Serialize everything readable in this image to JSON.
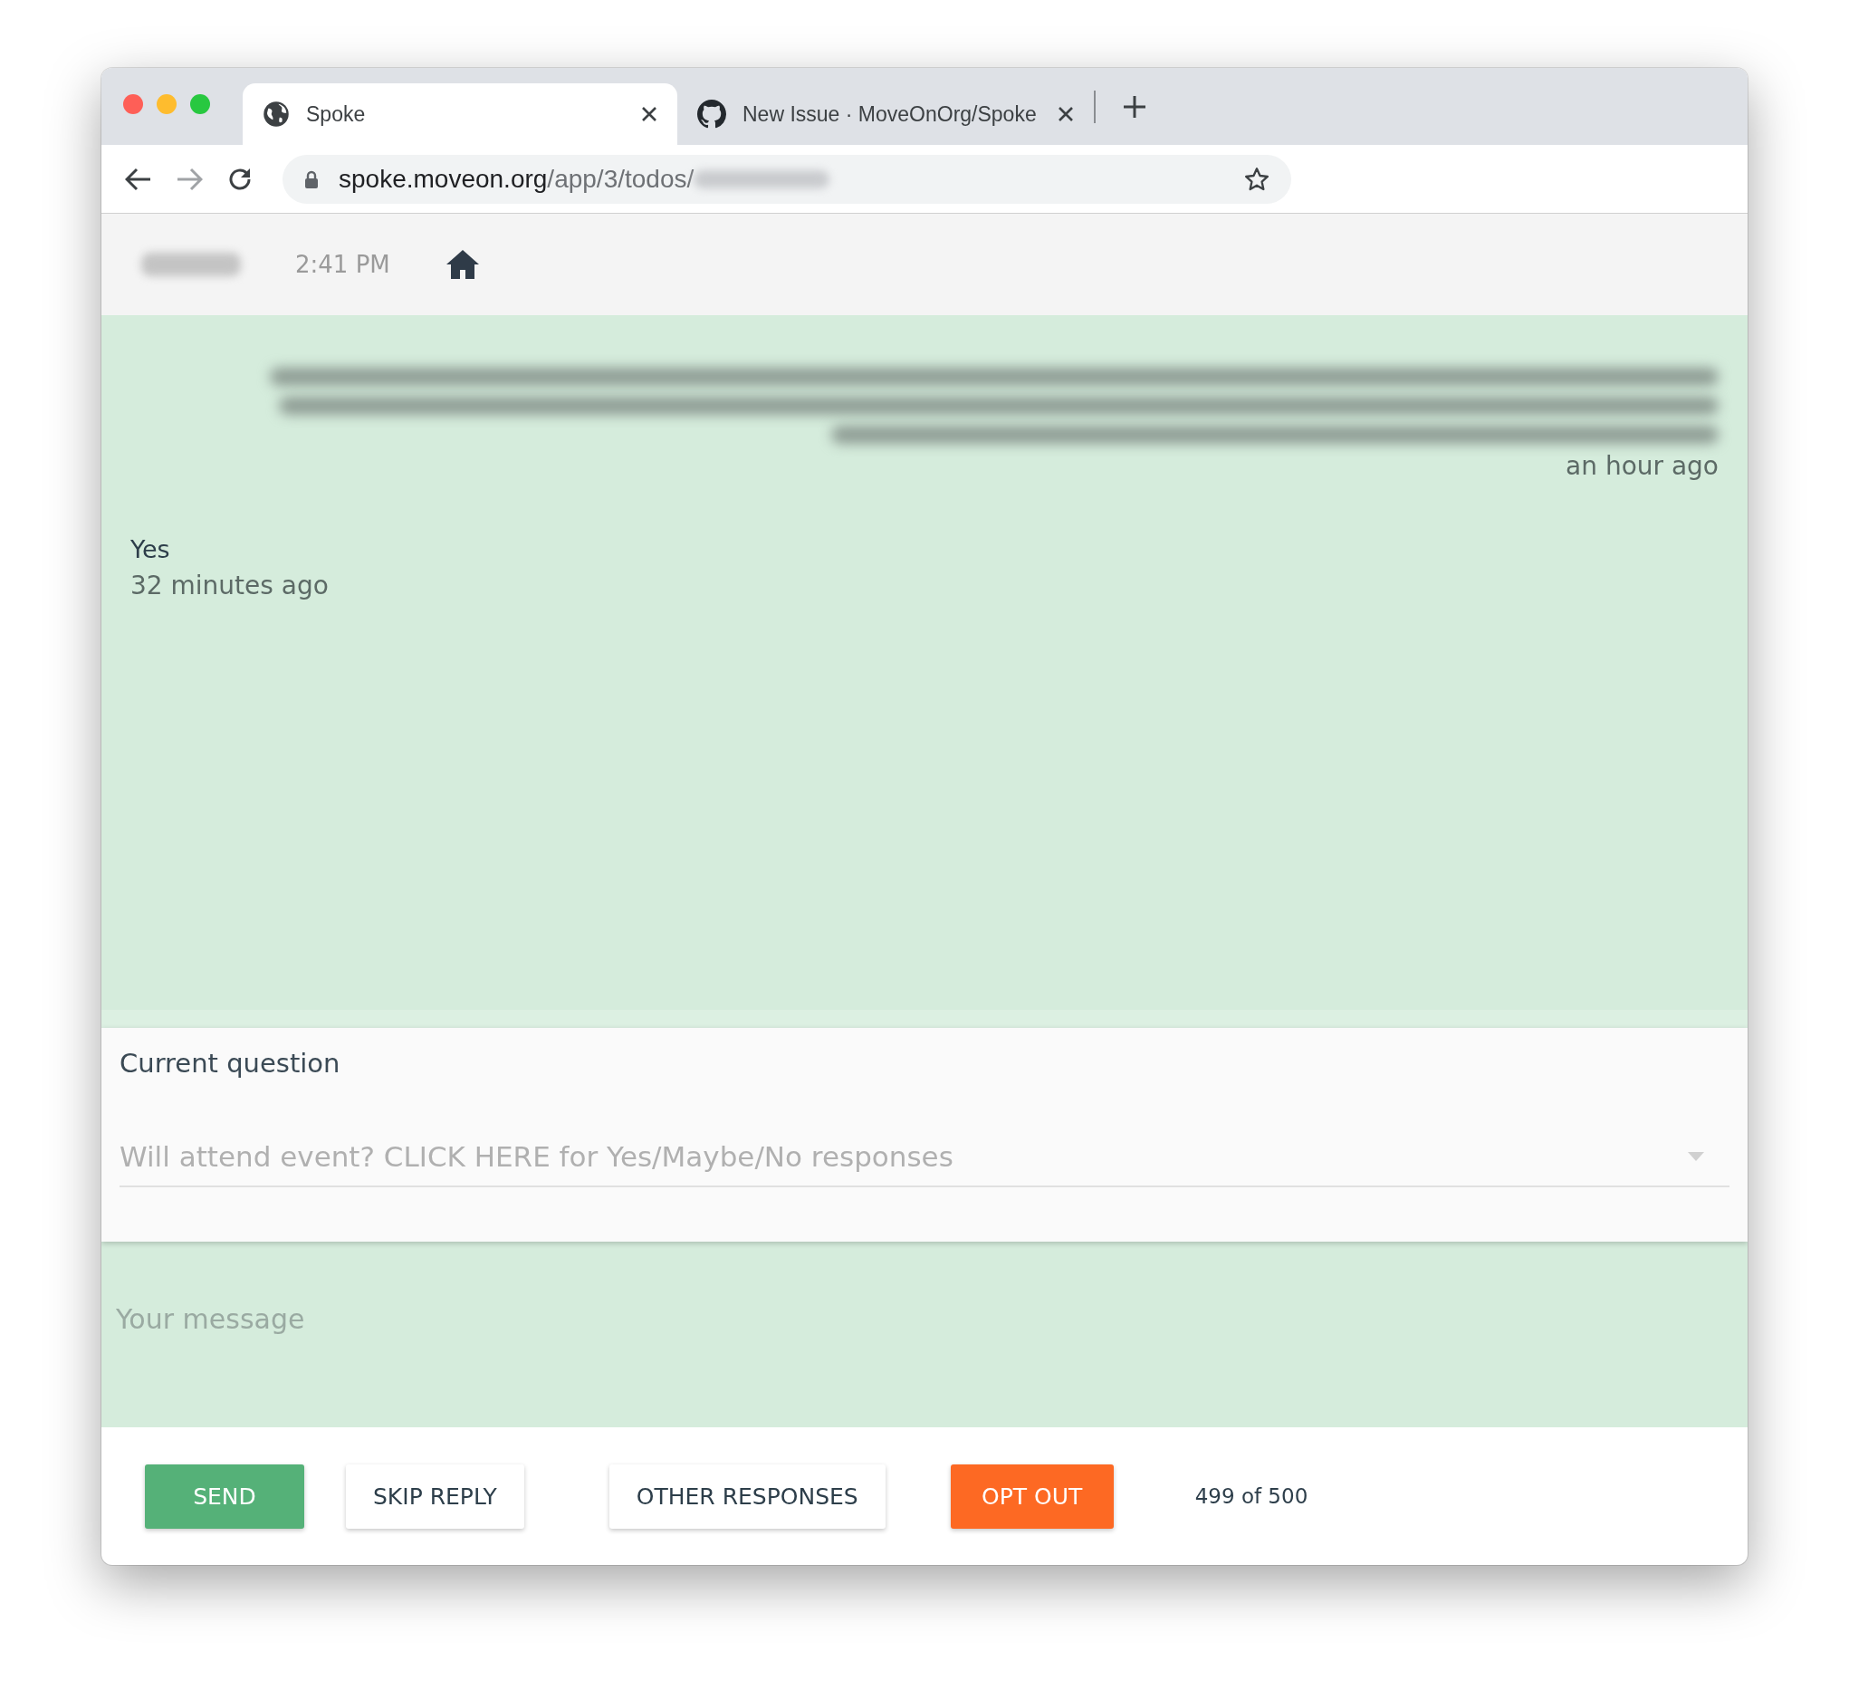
{
  "browser": {
    "tabs": [
      {
        "title": "Spoke",
        "kind": "globe",
        "selected": true
      },
      {
        "title": "New Issue · MoveOnOrg/Spoke",
        "kind": "github",
        "selected": false
      }
    ],
    "address": {
      "host": "spoke.moveon.org",
      "path": "/app/3/todos/"
    }
  },
  "header": {
    "time": "2:41 PM"
  },
  "messages": [
    {
      "kind": "outbound",
      "time": "an hour ago"
    },
    {
      "kind": "inbound",
      "text": "Yes",
      "time": "32 minutes ago"
    }
  ],
  "question": {
    "title": "Current question",
    "placeholder": "Will attend event? CLICK HERE for Yes/Maybe/No responses"
  },
  "reply": {
    "placeholder": "Your message"
  },
  "actions": [
    {
      "label": "SEND",
      "kind": "primary"
    },
    {
      "label": "SKIP REPLY",
      "kind": "plain"
    },
    {
      "label": "OTHER RESPONSES",
      "kind": "plain"
    },
    {
      "label": "OPT OUT",
      "kind": "danger"
    }
  ],
  "counter": "499 of 500"
}
